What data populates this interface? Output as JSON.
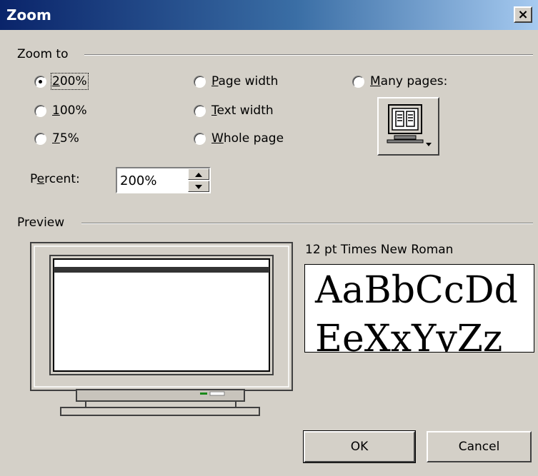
{
  "title": "Zoom",
  "close_label": "×",
  "zoom_group": {
    "label": "Zoom to",
    "options": [
      {
        "label": "200%",
        "checked": true
      },
      {
        "label": "100%",
        "checked": false
      },
      {
        "label": "75%",
        "checked": false
      },
      {
        "label": "Page width",
        "checked": false
      },
      {
        "label": "Text width",
        "checked": false
      },
      {
        "label": "Whole page",
        "checked": false
      },
      {
        "label": "Many pages:",
        "checked": false
      }
    ]
  },
  "percent": {
    "label": "Percent:",
    "value": "200%"
  },
  "preview": {
    "label": "Preview",
    "font_name": "12 pt Times New Roman",
    "sample_line1": "AaBbCcDd",
    "sample_line2": "EeXxYyZz"
  },
  "buttons": {
    "ok": "OK",
    "cancel": "Cancel"
  },
  "colors": {
    "title_start": "#0a246a",
    "title_end": "#a6caf0",
    "face": "#d4d0c8"
  },
  "icons": {
    "many_pages": "many-pages-monitor-icon",
    "close": "close-icon",
    "spin_up": "arrow-up-icon",
    "spin_down": "arrow-down-icon"
  }
}
